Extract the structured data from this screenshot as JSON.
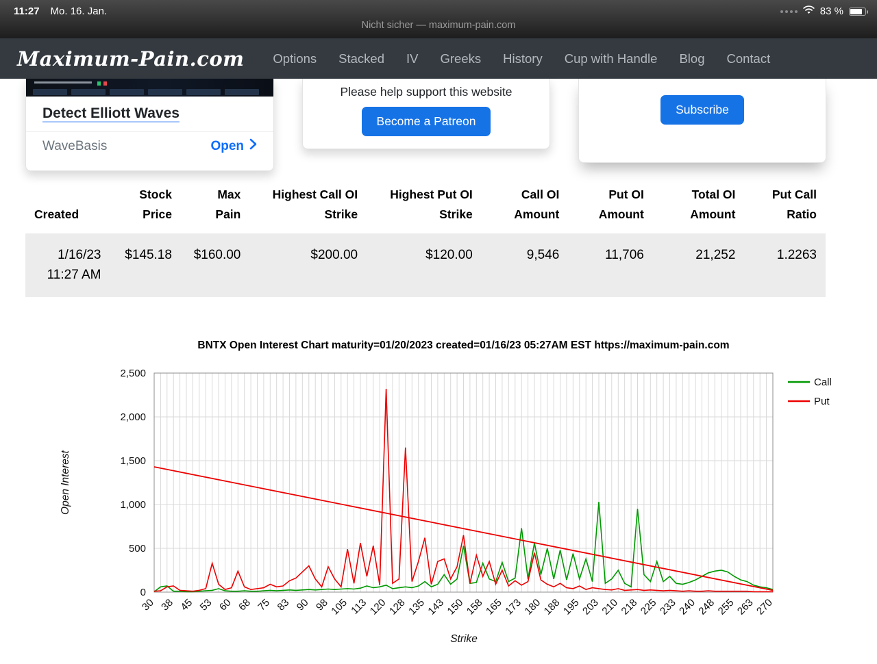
{
  "status_bar": {
    "time": "11:27",
    "date": "Mo. 16. Jan.",
    "battery": "83 %"
  },
  "url_bar": {
    "text": "Nicht sicher — maximum-pain.com"
  },
  "nav": {
    "logo": "Maximum-Pain.com",
    "items": [
      {
        "label": "Options"
      },
      {
        "label": "Stacked"
      },
      {
        "label": "IV"
      },
      {
        "label": "Greeks"
      },
      {
        "label": "History"
      },
      {
        "label": "Cup with Handle"
      },
      {
        "label": "Blog"
      },
      {
        "label": "Contact"
      }
    ]
  },
  "cards": {
    "elliott": {
      "title": "Detect Elliott Waves",
      "source": "WaveBasis",
      "action": "Open"
    },
    "patreon": {
      "message": "Please help support this website",
      "button": "Become a Patreon"
    },
    "newsletter": {
      "button": "Subscribe"
    }
  },
  "table": {
    "headers": [
      {
        "line1": "Created",
        "line2": ""
      },
      {
        "line1": "Stock",
        "line2": "Price"
      },
      {
        "line1": "Max",
        "line2": "Pain"
      },
      {
        "line1": "Highest Call OI",
        "line2": "Strike"
      },
      {
        "line1": "Highest Put OI",
        "line2": "Strike"
      },
      {
        "line1": "Call OI",
        "line2": "Amount"
      },
      {
        "line1": "Put OI",
        "line2": "Amount"
      },
      {
        "line1": "Total OI",
        "line2": "Amount"
      },
      {
        "line1": "Put Call",
        "line2": "Ratio"
      }
    ],
    "row": {
      "created_line1": "1/16/23",
      "created_line2": "11:27 AM",
      "stock_price": "$145.18",
      "max_pain": "$160.00",
      "highest_call_oi_strike": "$200.00",
      "highest_put_oi_strike": "$120.00",
      "call_oi_amount": "9,546",
      "put_oi_amount": "11,706",
      "total_oi_amount": "21,252",
      "put_call_ratio": "1.2263"
    }
  },
  "colors": {
    "accent_blue": "#1673e6",
    "link_blue": "#0d6efd",
    "navbar_bg": "#343a40",
    "call_green": "#009900",
    "put_red": "#ee0000"
  },
  "chart_data": {
    "type": "line",
    "title": "BNTX Open Interest Chart maturity=01/20/2023 created=01/16/23 05:27AM EST https://maximum-pain.com",
    "xlabel": "Strike",
    "ylabel": "Open Interest",
    "ylim": [
      0,
      2500
    ],
    "grid": true,
    "legend_position": "top-right",
    "ytick_values": [
      0,
      500,
      1000,
      1500,
      2000,
      2500
    ],
    "ytick_labels": [
      "0",
      "500",
      "1,000",
      "1,500",
      "2,000",
      "2,500"
    ],
    "x": [
      30,
      32.5,
      35,
      37.5,
      40,
      42.5,
      45,
      47.5,
      50,
      52.5,
      55,
      57.5,
      60,
      62.5,
      65,
      67.5,
      70,
      72.5,
      75,
      77.5,
      80,
      82.5,
      85,
      87.5,
      90,
      92.5,
      95,
      97.5,
      100,
      102.5,
      105,
      107.5,
      110,
      112.5,
      115,
      117.5,
      120,
      122.5,
      125,
      127.5,
      130,
      132.5,
      135,
      137.5,
      140,
      142.5,
      145,
      147.5,
      150,
      152.5,
      155,
      157.5,
      160,
      162.5,
      165,
      167.5,
      170,
      172.5,
      175,
      177.5,
      180,
      182.5,
      185,
      187.5,
      190,
      192.5,
      195,
      197.5,
      200,
      202.5,
      205,
      207.5,
      210,
      212.5,
      215,
      217.5,
      220,
      222.5,
      225,
      227.5,
      230,
      232.5,
      235,
      237.5,
      240,
      242.5,
      245,
      247.5,
      250,
      252.5,
      255,
      257.5,
      260,
      262.5,
      265,
      267.5,
      270
    ],
    "x_tick_every": 3,
    "x_tick_labels": [
      "30",
      "38",
      "45",
      "53",
      "60",
      "68",
      "75",
      "83",
      "90",
      "98",
      "105",
      "113",
      "120",
      "128",
      "135",
      "143",
      "150",
      "158",
      "165",
      "173",
      "180",
      "188",
      "195",
      "203",
      "210",
      "218",
      "225",
      "233",
      "240",
      "248",
      "255",
      "263",
      "270"
    ],
    "series": [
      {
        "name": "Call",
        "color": "#009900",
        "values": [
          5,
          60,
          70,
          10,
          10,
          5,
          5,
          10,
          15,
          20,
          40,
          15,
          10,
          10,
          15,
          10,
          10,
          15,
          20,
          15,
          20,
          25,
          20,
          25,
          30,
          25,
          30,
          35,
          30,
          35,
          40,
          35,
          45,
          70,
          50,
          60,
          80,
          40,
          50,
          60,
          50,
          70,
          120,
          60,
          90,
          200,
          90,
          150,
          530,
          100,
          110,
          330,
          150,
          120,
          340,
          120,
          160,
          730,
          150,
          560,
          200,
          500,
          150,
          480,
          140,
          440,
          150,
          380,
          120,
          1030,
          100,
          150,
          250,
          100,
          60,
          950,
          200,
          120,
          350,
          120,
          180,
          100,
          90,
          110,
          140,
          180,
          220,
          240,
          250,
          230,
          180,
          140,
          120,
          80,
          60,
          50,
          30
        ]
      },
      {
        "name": "Put",
        "color": "#ee0000",
        "values": [
          10,
          15,
          60,
          70,
          20,
          15,
          10,
          20,
          40,
          330,
          90,
          30,
          50,
          240,
          60,
          30,
          40,
          50,
          90,
          60,
          70,
          130,
          160,
          230,
          300,
          150,
          60,
          290,
          150,
          60,
          490,
          100,
          560,
          180,
          530,
          80,
          2320,
          100,
          150,
          1650,
          120,
          350,
          620,
          90,
          350,
          380,
          150,
          290,
          650,
          100,
          420,
          180,
          350,
          90,
          250,
          70,
          130,
          80,
          120,
          450,
          140,
          90,
          60,
          100,
          50,
          40,
          70,
          30,
          50,
          40,
          30,
          25,
          40,
          20,
          25,
          30,
          20,
          25,
          20,
          15,
          20,
          15,
          10,
          15,
          10,
          10,
          15,
          10,
          10,
          10,
          10,
          10,
          10,
          5,
          5,
          5,
          5
        ]
      }
    ],
    "put_trend_line": {
      "from": {
        "strike": 30,
        "oi": 1430
      },
      "to": {
        "strike": 270,
        "oi": 20
      },
      "color": "#ee0000"
    }
  }
}
